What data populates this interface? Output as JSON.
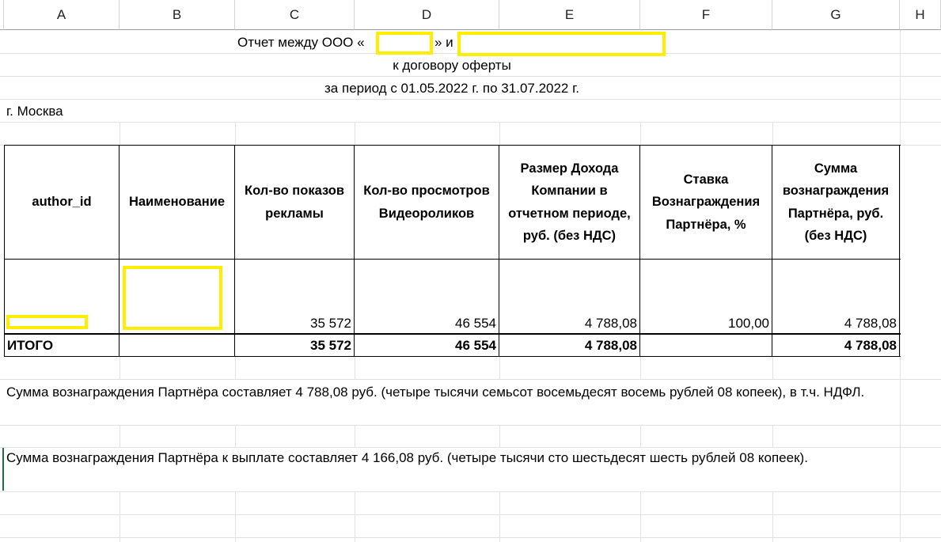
{
  "columns": [
    "A",
    "B",
    "C",
    "D",
    "E",
    "F",
    "G",
    "H"
  ],
  "title": {
    "prefix": "Отчет между ООО «",
    "middle": "» и",
    "line2": "к договору оферты",
    "line3": "за период с 01.05.2022 г. по 31.07.2022 г."
  },
  "city": "г. Москва",
  "table": {
    "headers": [
      "author_id",
      "Наименование",
      "Кол-во показов рекламы",
      "Кол-во просмотров Видеороликов",
      "Размер Дохода Компании в отчетном периоде, руб. (без НДС)",
      "Ставка Вознаграждения Партнёра, %",
      "Сумма вознаграждения Партнёра, руб. (без НДС)"
    ],
    "row": [
      "",
      "",
      "35 572",
      "46 554",
      "4 788,08",
      "100,00",
      "4 788,08"
    ],
    "total": [
      "ИТОГО",
      "",
      "35 572",
      "46 554",
      "4 788,08",
      "",
      "4 788,08"
    ]
  },
  "notes": [
    "Сумма вознаграждения Партнёра составляет 4 788,08 руб. (четыре тысячи семьсот восемьдесят восемь рублей 08 копеек), в т.ч. НДФЛ.",
    "Сумма вознаграждения Партнёра к выплате составляет 4 166,08 руб. (четыре тысячи сто шестьдесят шесть рублей 08 копеек)."
  ],
  "colors": {
    "highlight": "#ffee00",
    "grid": "#e1e1e1",
    "border": "#000000"
  }
}
